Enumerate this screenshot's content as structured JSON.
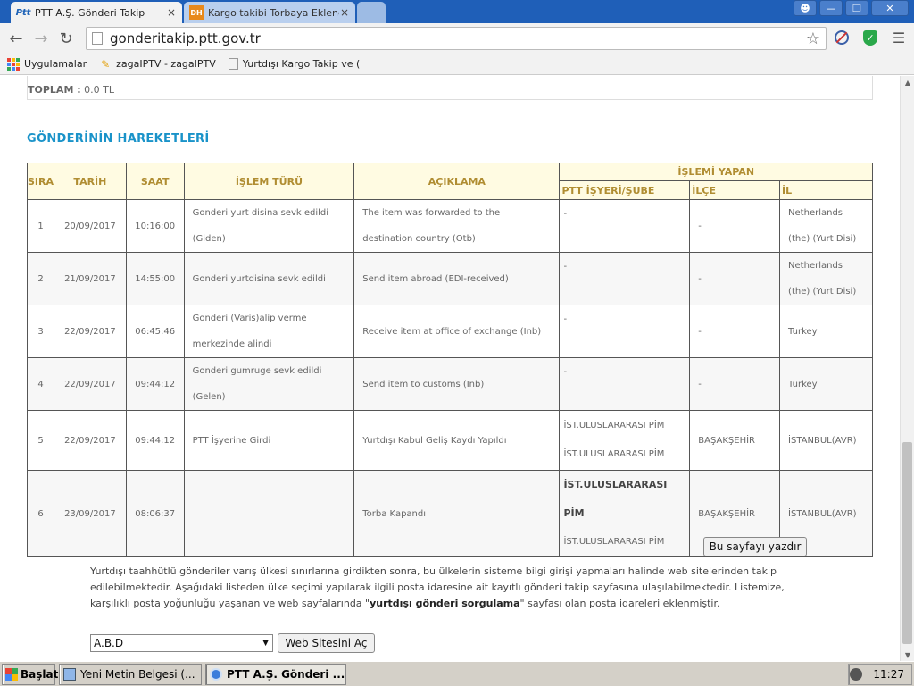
{
  "browser": {
    "tabs": [
      {
        "label": "PTT A.Ş. Gönderi Takip",
        "icon": "ptt-favicon",
        "close": "×"
      },
      {
        "label": "Kargo takibi Torbaya Eklendi",
        "icon": "dh-favicon",
        "icon_text": "DH",
        "close": "×"
      }
    ],
    "url": "gonderitakip.ptt.gov.tr",
    "bookmarks": [
      {
        "label": "Uygulamalar",
        "icon": "apps-icon"
      },
      {
        "label": "zagaIPTV - zagaIPTV",
        "icon": "pencil-icon"
      },
      {
        "label": "Yurtdışı Kargo Takip ve (",
        "icon": "page-icon"
      }
    ]
  },
  "page": {
    "toplam_label": "TOPLAM :",
    "toplam_value": "0.0 TL",
    "section_title": "GÖNDERİNİN HAREKETLERİ",
    "table": {
      "headers": {
        "sira": "SIRA",
        "tarih": "TARİH",
        "saat": "SAAT",
        "islem_turu": "İŞLEM TÜRÜ",
        "aciklama": "AÇIKLAMA",
        "islemi_yapan": "İŞLEMİ YAPAN",
        "ptt_isyeri": "PTT İŞYERİ/ŞUBE",
        "ilce": "İLÇE",
        "il": "İL"
      },
      "rows": [
        {
          "sira": "1",
          "tarih": "20/09/2017",
          "saat": "10:16:00",
          "islem_turu": "Gonderi yurt disina sevk edildi (Giden)",
          "aciklama": "The item was forwarded to the destination country (Otb)",
          "isyeri": "-",
          "ilce": "-",
          "il": "Netherlands (the) (Yurt Disi)"
        },
        {
          "sira": "2",
          "tarih": "21/09/2017",
          "saat": "14:55:00",
          "islem_turu": "Gonderi yurtdisina sevk edildi",
          "aciklama": "Send item abroad (EDI-received)",
          "isyeri": "-",
          "ilce": "-",
          "il": "Netherlands (the) (Yurt Disi)"
        },
        {
          "sira": "3",
          "tarih": "22/09/2017",
          "saat": "06:45:46",
          "islem_turu": "Gonderi (Varis)alip verme merkezinde alindi",
          "aciklama": "Receive item at office of exchange (Inb)",
          "isyeri": "-",
          "ilce": "-",
          "il": "Turkey"
        },
        {
          "sira": "4",
          "tarih": "22/09/2017",
          "saat": "09:44:12",
          "islem_turu": "Gonderi gumruge sevk edildi (Gelen)",
          "aciklama": "Send item to customs (Inb)",
          "isyeri": "-",
          "ilce": "-",
          "il": "Turkey"
        },
        {
          "sira": "5",
          "tarih": "22/09/2017",
          "saat": "09:44:12",
          "islem_turu": "PTT İşyerine Girdi",
          "aciklama": "Yurtdışı Kabul Geliş Kaydı Yapıldı",
          "isyeri_line1": "İST.ULUSLARARASI PİM",
          "isyeri_line2": "İST.ULUSLARARASI PİM",
          "ilce": "BAŞAKŞEHİR",
          "il": "İSTANBUL(AVR)"
        },
        {
          "sira": "6",
          "tarih": "23/09/2017",
          "saat": "08:06:37",
          "islem_turu": "",
          "aciklama": "Torba Kapandı",
          "isyeri_line1": "İST.ULUSLARARASI PİM",
          "isyeri_line2": "İST.ULUSLARARASI PİM",
          "ilce": "BAŞAKŞEHİR",
          "il": "İSTANBUL(AVR)"
        }
      ]
    },
    "print_button": "Bu sayfayı yazdır",
    "info_text_1": "Yurtdışı taahhütlü gönderiler varış ülkesi sınırlarına girdikten sonra, bu ülkelerin sisteme bilgi girişi yapmaları halinde web sitelerinden takip edilebilmektedir. Aşağıdaki listeden ülke seçimi yapılarak ilgili posta idaresine ait  kayıtlı gönderi takip  sayfasına ulaşılabilmektedir. Listemize, karşılıklı posta yoğunluğu yaşanan ve web sayfalarında \"",
    "info_text_bold": "yurtdışı gönderi sorgulama",
    "info_text_2": "\" sayfası olan posta idareleri eklenmiştir.",
    "country_selected": "A.B.D",
    "site_button": "Web Sitesini Aç"
  },
  "taskbar": {
    "start": "Başlat",
    "tasks": [
      {
        "label": "Yeni Metin Belgesi (..."
      },
      {
        "label": "PTT A.Ş. Gönderi ..."
      }
    ],
    "clock": "11:27"
  }
}
